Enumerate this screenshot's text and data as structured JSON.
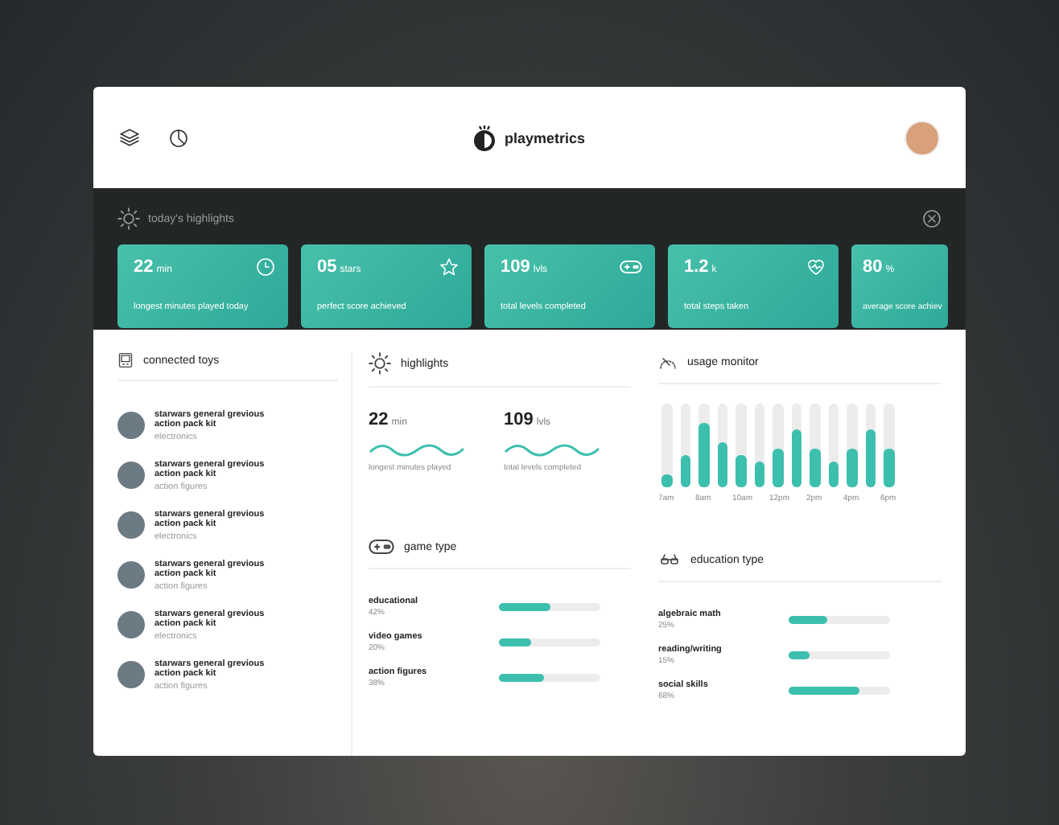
{
  "header": {
    "logo": "playmetrics"
  },
  "highlights": {
    "title": "today's highlights",
    "cards": [
      {
        "kind": "clock",
        "value": "22",
        "unit": "min",
        "label": "longest minutes played today"
      },
      {
        "kind": "star",
        "value": "05",
        "unit": "stars",
        "label": "perfect score achieved"
      },
      {
        "kind": "gamepad",
        "value": "109",
        "unit": "lvls",
        "label": "total levels completed"
      },
      {
        "kind": "heart",
        "value": "1.2",
        "unit": "k",
        "label": "total steps taken"
      },
      {
        "kind": "plain",
        "value": "80",
        "unit": "%",
        "label": "average score achiev"
      }
    ]
  },
  "connected_toys": {
    "title": "connected toys",
    "items": [
      {
        "name": "starwars general grevious action pack kit",
        "category": "electronics"
      },
      {
        "name": "starwars general grevious action pack kit",
        "category": "action figures"
      },
      {
        "name": "starwars general grevious action pack kit",
        "category": "electronics"
      },
      {
        "name": "starwars general grevious action pack kit",
        "category": "action figures"
      },
      {
        "name": "starwars general grevious action pack kit",
        "category": "electronics"
      },
      {
        "name": "starwars general grevious action pack kit",
        "category": "action figures"
      }
    ]
  },
  "highlights_panel": {
    "title": "highlights",
    "stats": [
      {
        "value": "22",
        "unit": "min",
        "label": "longest minutes played"
      },
      {
        "value": "109",
        "unit": "lvls",
        "label": "total levels completed"
      }
    ]
  },
  "usage_monitor": {
    "title": "usage monitor",
    "bars": [
      {
        "level": 0.16
      },
      {
        "level": 0.38
      },
      {
        "level": 0.77
      },
      {
        "level": 0.54
      },
      {
        "level": 0.39
      },
      {
        "level": 0.3
      },
      {
        "level": 0.46
      },
      {
        "level": 0.69
      },
      {
        "level": 0.46
      },
      {
        "level": 0.3
      },
      {
        "level": 0.46
      },
      {
        "level": 0.69
      },
      {
        "level": 0.46
      }
    ],
    "labels": [
      "7am",
      "8am",
      "10am",
      "12pm",
      "2pm",
      "4pm",
      "6pm"
    ]
  },
  "game_type": {
    "title": "game type",
    "items": [
      {
        "name": "educational",
        "percent": "42%",
        "level": 0.5
      },
      {
        "name": "video games",
        "percent": "20%",
        "level": 0.32
      },
      {
        "name": "action figures",
        "percent": "38%",
        "level": 0.45
      }
    ]
  },
  "education_type": {
    "title": "education type",
    "items": [
      {
        "name": "algebraic math",
        "percent": "25%",
        "level": 0.38
      },
      {
        "name": "reading/writing",
        "percent": "15%",
        "level": 0.2
      },
      {
        "name": "social skills",
        "percent": "68%",
        "level": 0.7
      }
    ]
  }
}
